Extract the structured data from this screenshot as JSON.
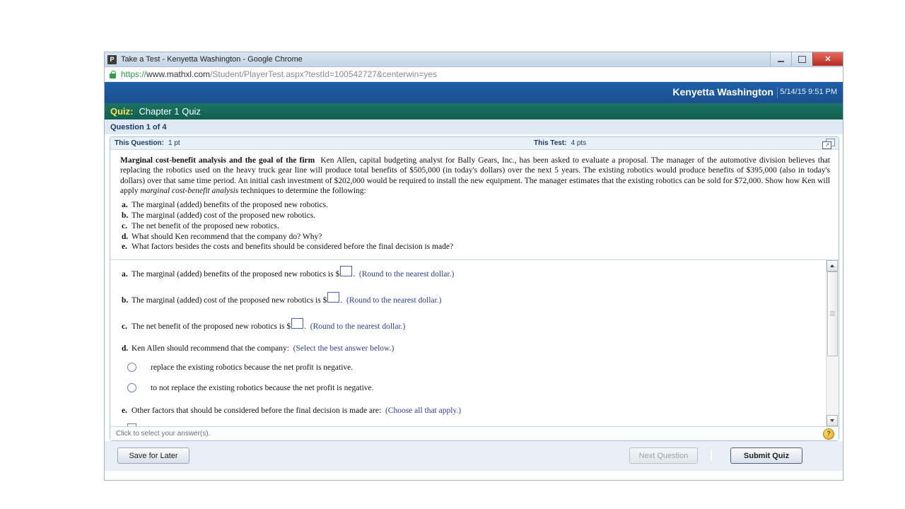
{
  "browser": {
    "favicon_letter": "P",
    "tab_title": "Take a Test - Kenyetta Washington - Google Chrome",
    "url_scheme": "https://",
    "url_host": "www.mathxl.com",
    "url_path": "/Student/PlayerTest.aspx?testId=100542727&centerwin=yes",
    "window_buttons": {
      "minimize": "–",
      "maximize": "❐",
      "close": "✕"
    }
  },
  "appbar": {
    "user_name": "Kenyetta Washington",
    "datetime": "5/14/15 9:51 PM"
  },
  "quizbar": {
    "label": "Quiz:",
    "title": "Chapter 1 Quiz"
  },
  "question_nav": {
    "text": "Question 1 of 4"
  },
  "question_header": {
    "this_question_label": "This Question:",
    "this_question_value": "1 pt",
    "this_test_label": "This Test:",
    "this_test_value": "4 pts",
    "popout_icon": "popout-window-icon"
  },
  "stem": {
    "title": "Marginal cost-benefit analysis and the goal of the firm",
    "body_1": "Ken Allen, capital budgeting analyst for Bally Gears, Inc., has been asked to evaluate a proposal.  The manager of the automotive division believes that replacing the robotics used on the heavy truck gear line will produce total benefits of $505,000 (in today's dollars) over the next 5 years.  The existing robotics would produce benefits of $395,000 (also in today's dollars) over that same time period.  An initial cash investment of $202,000 would be required to install the new equipment.  The manager estimates that the existing robotics can be sold for $72,000.  Show how Ken will apply ",
    "italic_phrase": "marginal cost-benefit analysis",
    "body_2": " techniques to determine the following:"
  },
  "parts": [
    {
      "letter": "a.",
      "text": "The marginal (added) benefits of the proposed new robotics."
    },
    {
      "letter": "b.",
      "text": "The marginal (added) cost of the proposed new robotics."
    },
    {
      "letter": "c.",
      "text": "The net benefit of the proposed new robotics."
    },
    {
      "letter": "d.",
      "text": "What should Ken recommend that the company do? Why?"
    },
    {
      "letter": "e.",
      "text": "What factors besides the costs and benefits should be considered before the final decision is made?"
    }
  ],
  "answers": {
    "a": {
      "letter": "a.",
      "text_before": "The marginal (added) benefits of the proposed new robotics is $",
      "text_after": ".",
      "hint": "(Round to the nearest dollar.)",
      "value": ""
    },
    "b": {
      "letter": "b.",
      "text_before": "The marginal (added) cost of the proposed new robotics is $",
      "text_after": ".",
      "hint": "(Round to the nearest dollar.)",
      "value": ""
    },
    "c": {
      "letter": "c.",
      "text_before": "The net benefit of the proposed new robotics is $",
      "text_after": ".",
      "hint": "(Round to the nearest dollar.)",
      "value": ""
    },
    "d": {
      "letter": "d.",
      "text": "Ken Allen should recommend that the company:",
      "hint": "(Select the best answer below.)",
      "options": [
        "replace the existing robotics because the net profit is negative.",
        "to not replace the existing robotics because the net profit is negative."
      ]
    },
    "e": {
      "letter": "e.",
      "text": "Other factors that should be considered before the final decision is made are:",
      "hint": "(Choose all that apply.)"
    }
  },
  "status": {
    "text": "Click to select your answer(s).",
    "help_icon": "help-question-icon",
    "help_glyph": "?"
  },
  "footer": {
    "save_label": "Save for Later",
    "next_label": "Next Question",
    "submit_label": "Submit Quiz"
  },
  "scrollbar": {
    "up_icon": "scroll-up-arrow-icon",
    "down_icon": "scroll-down-arrow-icon"
  },
  "colors": {
    "appbar_blue": "#1b4f8f",
    "quiz_green": "#116050",
    "quiz_yellow": "#ffe14d",
    "link_blue": "#2b3f96",
    "lock_green": "#2e9e4a"
  }
}
